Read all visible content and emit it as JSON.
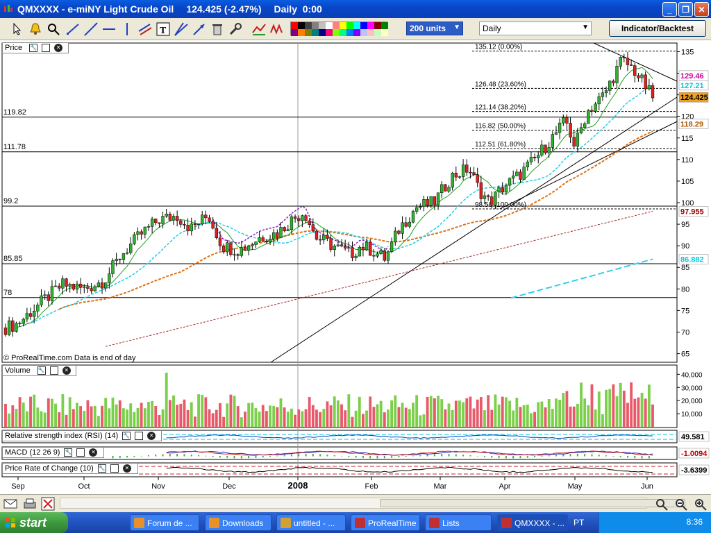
{
  "window": {
    "symbol": "QMXXXX - e-miNY Light Crude Oil",
    "price_change": "124.425 (-2.47%)",
    "period_time": "Daily  0:00"
  },
  "toolbar": {
    "units_label": "200 units",
    "period_label": "Daily",
    "indicator_button": "Indicator/Backtest",
    "swatch_colors": [
      "#ff0000",
      "#000000",
      "#404040",
      "#808080",
      "#c0c0c0",
      "#ffffff",
      "#ff8080",
      "#ffff00",
      "#00ff00",
      "#00ffff",
      "#0000ff",
      "#ff00ff",
      "#800000",
      "#008000",
      "#800080",
      "#ff8000",
      "#808000",
      "#008080",
      "#000080",
      "#ff0080",
      "#80ff00",
      "#00ff80",
      "#0080ff",
      "#8000ff",
      "#c0c0ff",
      "#ffc0c0",
      "#c0ffc0",
      "#ffffc0"
    ]
  },
  "price_panel": {
    "title": "Price",
    "watermark": "© ProRealTime.com  Data is end of day",
    "y_ticks": [
      "135",
      "130",
      "125",
      "120",
      "115",
      "110",
      "105",
      "100",
      "95",
      "90",
      "85",
      "80",
      "75",
      "70",
      "65"
    ],
    "levels": [
      {
        "label": "119.82",
        "value": 119.82
      },
      {
        "label": "111.78",
        "value": 111.78
      },
      {
        "label": "99.2",
        "value": 99.2
      },
      {
        "label": "85.85",
        "value": 85.85
      },
      {
        "label": "78",
        "value": 78
      }
    ],
    "fib_levels": [
      {
        "label": "135.12 (0.00%)",
        "value": 135.12
      },
      {
        "label": "126.48 (23.60%)",
        "value": 126.48
      },
      {
        "label": "121.14 (38.20%)",
        "value": 121.14
      },
      {
        "label": "116.82 (50.00%)",
        "value": 116.82
      },
      {
        "label": "112.51 (61.80%)",
        "value": 112.51
      },
      {
        "label": "98.56 (100.00%)",
        "value": 98.56
      }
    ],
    "badges": [
      {
        "text": "129.46",
        "value": 129.46,
        "color": "#cc0099",
        "bg": "#ffffff"
      },
      {
        "text": "127.21",
        "value": 127.21,
        "color": "#00c8e0",
        "bg": "#ffffff"
      },
      {
        "text": "124.425",
        "value": 124.425,
        "color": "#000000",
        "bg": "#f0a020"
      },
      {
        "text": "118.29",
        "value": 118.29,
        "color": "#b05a00",
        "bg": "#ffffff"
      },
      {
        "text": "97.955",
        "value": 97.955,
        "color": "#a00000",
        "bg": "#ffffff"
      },
      {
        "text": "86.882",
        "value": 86.882,
        "color": "#00c8e0",
        "bg": "#ffffff"
      }
    ]
  },
  "volume_panel": {
    "title": "Volume",
    "y_ticks": [
      "40,000",
      "30,000",
      "20,000",
      "10,000"
    ]
  },
  "rsi_panel": {
    "title": "Relative strength index (RSI) (14)",
    "value": "49.581"
  },
  "macd_panel": {
    "title": "MACD (12 26 9)",
    "value": "-1.0094"
  },
  "roc_panel": {
    "title": "Price Rate of Change (10)",
    "value": "-3.6399"
  },
  "x_axis": {
    "labels": [
      {
        "text": "Sep",
        "bold": false
      },
      {
        "text": "Oct",
        "bold": false
      },
      {
        "text": "Nov",
        "bold": false
      },
      {
        "text": "Dec",
        "bold": false
      },
      {
        "text": "2008",
        "bold": true
      },
      {
        "text": "Feb",
        "bold": false
      },
      {
        "text": "Mar",
        "bold": false
      },
      {
        "text": "Apr",
        "bold": false
      },
      {
        "text": "May",
        "bold": false
      },
      {
        "text": "Jun",
        "bold": false
      }
    ]
  },
  "chart_data": {
    "type": "candlestick",
    "ylim": [
      63,
      137
    ],
    "anchors": [
      {
        "date": "Sep",
        "price": 72
      },
      {
        "date": "Oct",
        "price": 80
      },
      {
        "date": "Nov",
        "price": 95
      },
      {
        "date": "Dec",
        "price": 89
      },
      {
        "date": "2008",
        "price": 97
      },
      {
        "date": "Feb",
        "price": 89
      },
      {
        "date": "Mar",
        "price": 108
      },
      {
        "date": "Apr",
        "price": 104
      },
      {
        "date": "May",
        "price": 118
      },
      {
        "date": "Jun",
        "price": 125
      }
    ]
  },
  "taskbar": {
    "start_label": "start",
    "tasks": [
      "Forum de ...",
      "Downloads",
      "untitled - ...",
      "ProRealTime",
      "Lists",
      "QMXXXX - ..."
    ],
    "lang": "PT",
    "time": "8:36"
  }
}
